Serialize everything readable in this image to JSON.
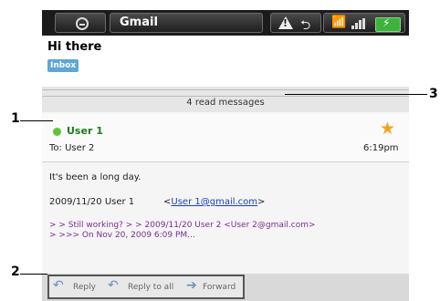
{
  "status_bar": {
    "app_name": "Gmail"
  },
  "conversation": {
    "subject": "Hi there",
    "label": "Inbox",
    "read_messages": "4 read messages"
  },
  "message": {
    "sender": "User 1",
    "to": "To: User 2",
    "time": "6:19pm",
    "body": "It's been a long day.",
    "quote_date_sender": "2009/11/20  User 1",
    "quote_email_prefix": "<",
    "quote_email": "User 1@gmail.com",
    "quote_email_suffix": ">",
    "quoted_line_1": "> > Still working? > > 2009/11/20 User 2 <User 2@gmail.com>",
    "quoted_line_2": "> >>> On Nov 20, 2009 6:09 PM..."
  },
  "actions": {
    "reply": "Reply",
    "reply_all": "Reply to all",
    "forward": "Forward"
  },
  "callouts": {
    "one": "1",
    "two": "2",
    "three": "3"
  },
  "colors": {
    "sender_green": "#1f7a1f",
    "presence_green": "#5fc33a",
    "star": "#f2a51c",
    "link_blue": "#1a3fb5",
    "quote_purple": "#7a2e8c"
  }
}
